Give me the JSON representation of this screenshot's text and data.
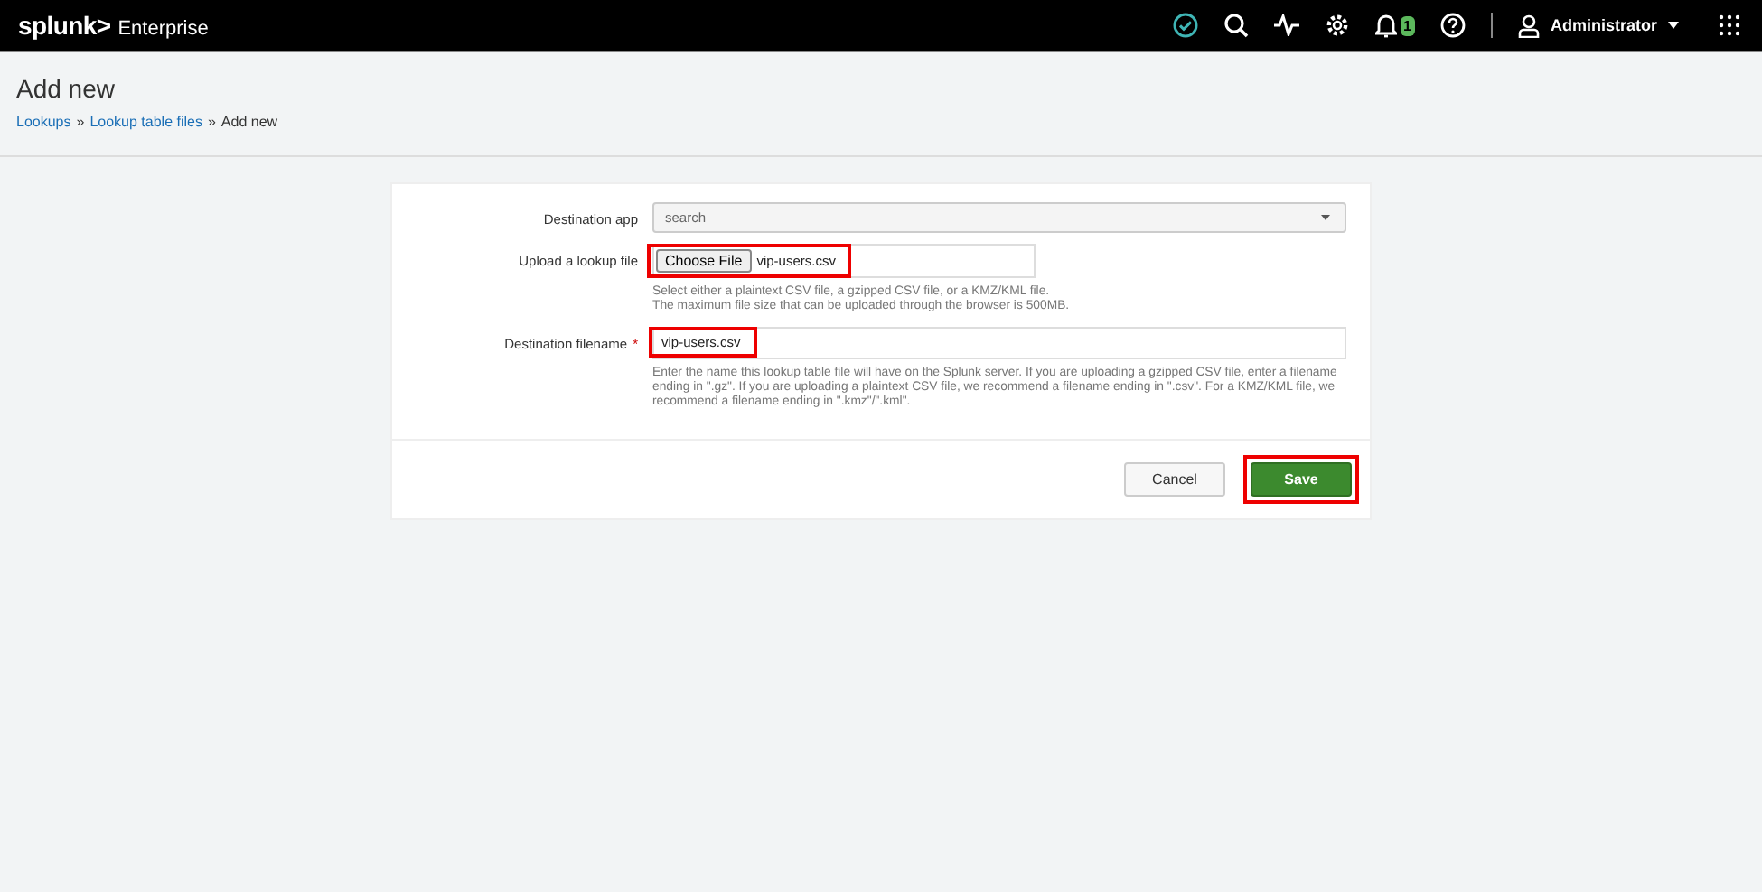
{
  "topbar": {
    "brand": "splunk>",
    "product": "Enterprise",
    "notification_count": "1",
    "user": "Administrator"
  },
  "page": {
    "title": "Add new",
    "breadcrumb_separator": "»",
    "breadcrumb": [
      {
        "label": "Lookups",
        "kind": "link"
      },
      {
        "label": "Lookup table files",
        "kind": "link"
      },
      {
        "label": "Add new",
        "kind": "current"
      }
    ]
  },
  "form": {
    "fields": [
      {
        "kind": "select",
        "label": "Destination app",
        "value": "search",
        "highlighted": false
      },
      {
        "kind": "file",
        "label": "Upload a lookup file",
        "button": "Choose File",
        "value": "vip-users.csv",
        "highlighted": true,
        "help": [
          "Select either a plaintext CSV file, a gzipped CSV file, or a KMZ/KML file.",
          "The maximum file size that can be uploaded through the browser is 500MB."
        ]
      },
      {
        "kind": "text",
        "label": "Destination filename",
        "required_mark": "*",
        "value": "vip-users.csv",
        "highlighted": true,
        "help": [
          "Enter the name this lookup table file will have on the Splunk server. If you are uploading a gzipped CSV file, enter a filename ending in \".gz\". If you are uploading a plaintext CSV file, we recommend a filename ending in \".csv\". For a KMZ/KML file, we recommend a filename ending in \".kmz\"/\".kml\"."
        ]
      }
    ],
    "buttons": [
      {
        "label": "Cancel",
        "kind": "secondary",
        "highlighted": false
      },
      {
        "label": "Save",
        "kind": "primary",
        "highlighted": true
      }
    ]
  }
}
